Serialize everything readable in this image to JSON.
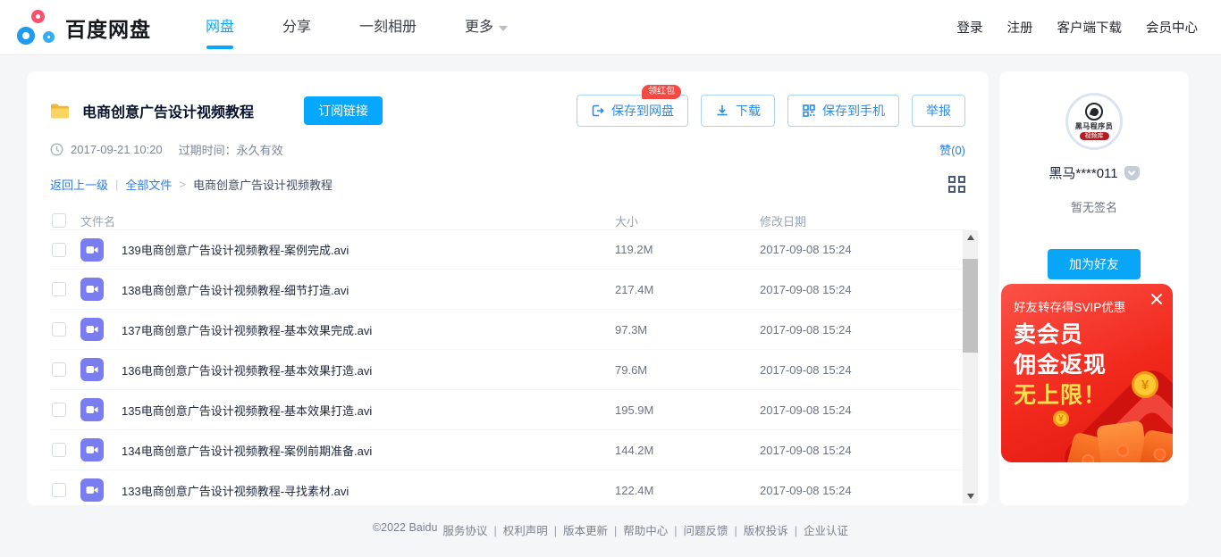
{
  "header": {
    "logo_text": "百度网盘",
    "nav": [
      {
        "label": "网盘"
      },
      {
        "label": "分享"
      },
      {
        "label": "一刻相册"
      },
      {
        "label": "更多"
      }
    ],
    "links": [
      {
        "label": "登录"
      },
      {
        "label": "注册"
      },
      {
        "label": "客户端下载"
      },
      {
        "label": "会员中心"
      }
    ]
  },
  "share": {
    "title": "电商创意广告设计视频教程",
    "subscribe_label": "订阅链接",
    "share_time": "2017-09-21 10:20",
    "expire_label": "过期时间：永久有效",
    "redpacket_badge": "领红包",
    "actions": {
      "save_to_netdisk": "保存到网盘",
      "download": "下载",
      "save_to_phone": "保存到手机",
      "report": "举报"
    },
    "like_label": "赞(0)"
  },
  "breadcrumb": {
    "back": "返回上一级",
    "all_files": "全部文件",
    "current": "电商创意广告设计视频教程"
  },
  "table": {
    "headers": {
      "name": "文件名",
      "size": "大小",
      "date": "修改日期"
    },
    "rows": [
      {
        "name": "139电商创意广告设计视频教程-案例完成.avi",
        "size": "119.2M",
        "date": "2017-09-08 15:24"
      },
      {
        "name": "138电商创意广告设计视频教程-细节打造.avi",
        "size": "217.4M",
        "date": "2017-09-08 15:24"
      },
      {
        "name": "137电商创意广告设计视频教程-基本效果完成.avi",
        "size": "97.3M",
        "date": "2017-09-08 15:24"
      },
      {
        "name": "136电商创意广告设计视频教程-基本效果打造.avi",
        "size": "79.6M",
        "date": "2017-09-08 15:24"
      },
      {
        "name": "135电商创意广告设计视频教程-基本效果打造.avi",
        "size": "195.9M",
        "date": "2017-09-08 15:24"
      },
      {
        "name": "134电商创意广告设计视频教程-案例前期准备.avi",
        "size": "144.2M",
        "date": "2017-09-08 15:24"
      },
      {
        "name": "133电商创意广告设计视频教程-寻找素材.avi",
        "size": "122.4M",
        "date": "2017-09-08 15:24"
      }
    ]
  },
  "profile": {
    "avatar_text": "黑马程序员",
    "avatar_strip": "视频库",
    "username": "黑马****011",
    "signature": "暂无签名",
    "add_friend_label": "加为好友"
  },
  "ad": {
    "line1": "好友转存得SVIP优惠",
    "line2": "卖会员",
    "line3": "佣金返现",
    "line4": "无上限！",
    "coin_symbol": "¥"
  },
  "footer": {
    "copyright": "©2022 Baidu",
    "links": [
      {
        "label": "服务协议"
      },
      {
        "label": "权利声明"
      },
      {
        "label": "版本更新"
      },
      {
        "label": "帮助中心"
      },
      {
        "label": "问题反馈"
      },
      {
        "label": "版权投诉"
      },
      {
        "label": "企业认证"
      }
    ]
  },
  "colors": {
    "accent_blue": "#06a7ff",
    "link_blue": "#2d7ceb",
    "file_icon_purple": "#7a7df0",
    "folder_yellow": "#f6c443",
    "badge_red": "#f34a43",
    "ad_red": "#ee2419",
    "ad_highlight_yellow": "#ffe14d"
  }
}
